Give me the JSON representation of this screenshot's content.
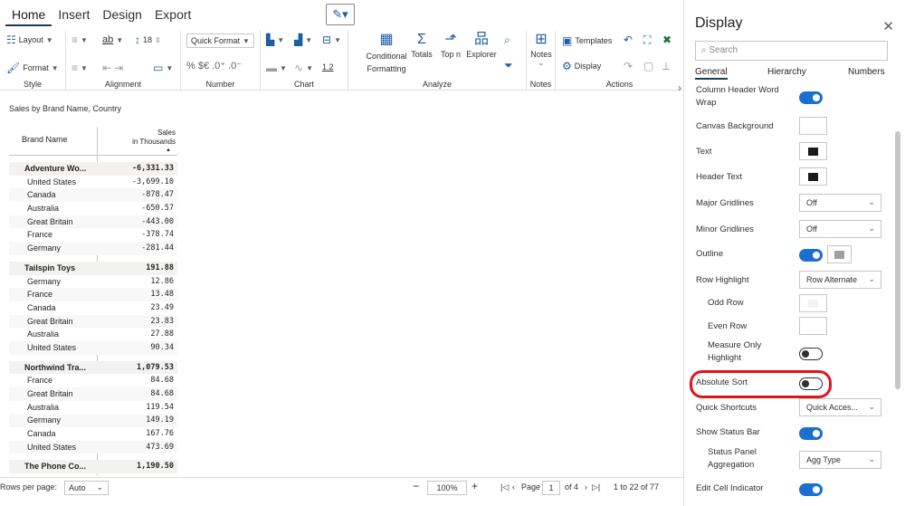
{
  "ribbon": {
    "tabs": [
      "Home",
      "Insert",
      "Design",
      "Export"
    ],
    "style": {
      "layout": "Layout",
      "format": "Format",
      "label": "Style"
    },
    "alignment": {
      "label": "Alignment",
      "font_size": "18"
    },
    "number": {
      "quick_format": "Quick Format",
      "currency": "% $€",
      "label": "Number"
    },
    "chart": {
      "label": "Chart",
      "value": "1.2"
    },
    "analyze": {
      "conditional_formatting": "Conditional Formatting",
      "totals": "Totals",
      "top_n": "Top n",
      "explorer": "Explorer",
      "label": "Analyze"
    },
    "notes": {
      "notes": "Notes",
      "label": "Notes"
    },
    "actions": {
      "templates": "Templates",
      "display": "Display",
      "label": "Actions"
    }
  },
  "report": {
    "title": "Sales by Brand Name, Country",
    "col_brand": "Brand Name",
    "col_sales_1": "Sales",
    "col_sales_2": "in Thousands",
    "groups": [
      {
        "brand": "Adventure Wo...",
        "total": "-6,331.33",
        "rows": [
          [
            "United States",
            "-3,699.10"
          ],
          [
            "Canada",
            "-878.47"
          ],
          [
            "Australia",
            "-650.57"
          ],
          [
            "Great Britain",
            "-443.00"
          ],
          [
            "France",
            "-378.74"
          ],
          [
            "Germany",
            "-281.44"
          ]
        ]
      },
      {
        "brand": "Tailspin Toys",
        "total": "191.88",
        "rows": [
          [
            "Germany",
            "12.86"
          ],
          [
            "France",
            "13.48"
          ],
          [
            "Canada",
            "23.49"
          ],
          [
            "Great Britain",
            "23.83"
          ],
          [
            "Australia",
            "27.88"
          ],
          [
            "United States",
            "90.34"
          ]
        ]
      },
      {
        "brand": "Northwind Tra...",
        "total": "1,079.53",
        "rows": [
          [
            "France",
            "84.68"
          ],
          [
            "Great Britain",
            "84.68"
          ],
          [
            "Australia",
            "119.54"
          ],
          [
            "Germany",
            "149.19"
          ],
          [
            "Canada",
            "167.76"
          ],
          [
            "United States",
            "473.69"
          ]
        ]
      },
      {
        "brand": "The Phone Co...",
        "total": "1,190.50",
        "rows": []
      }
    ]
  },
  "status": {
    "rows_per_page_label": "Rows per page:",
    "rows_per_page_value": "Auto",
    "zoom": "100%",
    "page_label": "Page",
    "page_value": "1",
    "page_of": "of 4",
    "range": "1 to 22 of 77"
  },
  "panel": {
    "title": "Display",
    "search_placeholder": "Search",
    "tabs": [
      "General",
      "Hierarchy",
      "Numbers"
    ],
    "props": {
      "column_header_word_wrap": "Column Header Word Wrap",
      "canvas_background": "Canvas Background",
      "text": "Text",
      "header_text": "Header Text",
      "major_gridlines": "Major Gridlines",
      "major_gridlines_value": "Off",
      "minor_gridlines": "Minor Gridlines",
      "minor_gridlines_value": "Off",
      "outline": "Outline",
      "row_highlight": "Row Highlight",
      "row_highlight_value": "Row Alternate",
      "odd_row": "Odd Row",
      "even_row": "Even Row",
      "measure_only_highlight": "Measure Only Highlight",
      "absolute_sort": "Absolute Sort",
      "quick_shortcuts": "Quick Shortcuts",
      "quick_shortcuts_value": "Quick Acces...",
      "show_status_bar": "Show Status Bar",
      "status_panel_aggregation": "Status Panel Aggregation",
      "status_panel_aggregation_value": "Agg Type",
      "edit_cell_indicator": "Edit Cell Indicator"
    },
    "toggles": {
      "column_header_word_wrap": true,
      "outline": true,
      "measure_only_highlight": false,
      "absolute_sort": false,
      "show_status_bar": true,
      "edit_cell_indicator": true
    },
    "colors": {
      "text": "#1b1b1b",
      "header_text": "#1b1b1b",
      "outline": "#a19f9d",
      "accent": "#1b6fd1",
      "highlight": "#e0141e"
    }
  }
}
